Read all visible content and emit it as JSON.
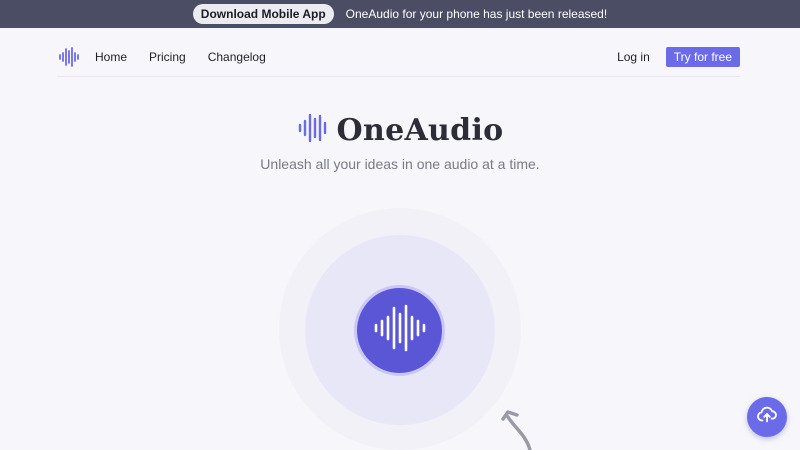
{
  "announcement": {
    "button_label": "Download Mobile App",
    "text": "OneAudio for your phone has just been released!"
  },
  "nav": {
    "logo_icon": "audio-wave-icon",
    "links": [
      {
        "label": "Home"
      },
      {
        "label": "Pricing"
      },
      {
        "label": "Changelog"
      }
    ],
    "login_label": "Log in",
    "cta_label": "Try for free"
  },
  "hero": {
    "brand_name": "OneAudio",
    "tagline": "Unleash all your ideas in one audio at a time.",
    "record_icon": "audio-wave-icon"
  },
  "upload_fab": {
    "icon": "cloud-upload-icon"
  },
  "colors": {
    "accent": "#6b6bea",
    "record": "#5a56d6",
    "announcement_bg": "#4a4d63"
  }
}
